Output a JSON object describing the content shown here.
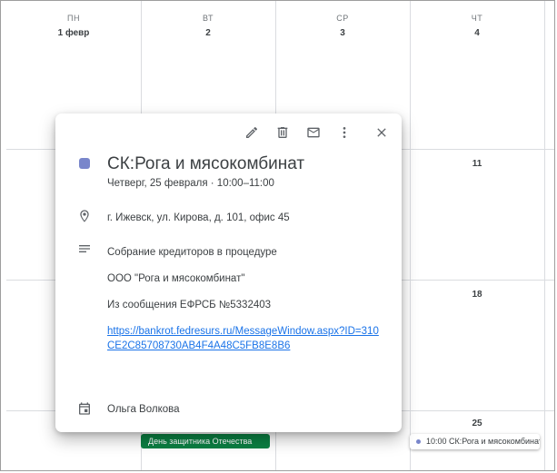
{
  "calendar": {
    "days": [
      {
        "name": "ПН",
        "date": "1 февр"
      },
      {
        "name": "ВТ",
        "date": "2"
      },
      {
        "name": "СР",
        "date": "3"
      },
      {
        "name": "ЧТ",
        "date": "4"
      }
    ],
    "week_dates": {
      "row2": "11",
      "row3": "18",
      "row4": "25"
    },
    "holiday_chip": "День защитника Отечества",
    "event_chip": {
      "time": "10:00",
      "title": "СК:Рога и мясокомбинат",
      "color": "#7986cb"
    }
  },
  "popup": {
    "title": "СК:Рога и мясокомбинат",
    "color": "#7986cb",
    "datetime": "Четверг, 25 февраля  ·  10:00–11:00",
    "location": "г. Ижевск, ул. Кирова, д. 101, офис 45",
    "description": {
      "line1": "Собрание кредиторов в процедуре",
      "line2": "ООО \"Рога и мясокомбинат\"",
      "line3": "Из сообщения ЕФРСБ №5332403",
      "link": "https://bankrot.fedresurs.ru/MessageWindow.aspx?ID=310CE2C85708730AB4F4A48C5FB8E8B6"
    },
    "organizer": "Ольга Волкова",
    "toolbar": {
      "edit_icon": "pencil-icon",
      "delete_icon": "trash-icon",
      "email_icon": "mail-icon",
      "more_icon": "more-vert-icon",
      "close_icon": "close-icon"
    }
  }
}
